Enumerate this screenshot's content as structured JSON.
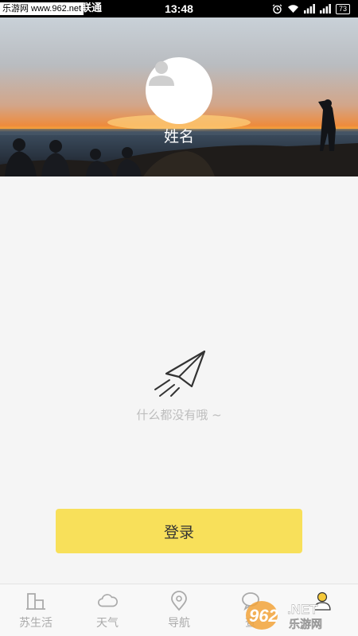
{
  "status_bar": {
    "watermark": "乐游网 www.962.net",
    "carrier": "联通",
    "time": "13:48",
    "battery": "73",
    "icons": [
      "alarm-icon",
      "wifi-icon",
      "signal-icon",
      "signal-icon",
      "battery-icon"
    ]
  },
  "profile": {
    "name": "姓名",
    "avatar_icon": "person-icon"
  },
  "empty_state": {
    "icon": "paper-plane-icon",
    "message": "什么都没有哦 ~"
  },
  "login": {
    "label": "登录",
    "color": "#f8e05a"
  },
  "bottom_nav": {
    "items": [
      {
        "label": "苏生活",
        "icon": "building-icon"
      },
      {
        "label": "天气",
        "icon": "cloud-icon"
      },
      {
        "label": "导航",
        "icon": "location-pin-icon"
      },
      {
        "label": "查",
        "icon": "chat-icon"
      },
      {
        "label": "",
        "icon": "user-icon"
      }
    ]
  },
  "brand_mark": {
    "text": "962.NET 乐游网"
  }
}
